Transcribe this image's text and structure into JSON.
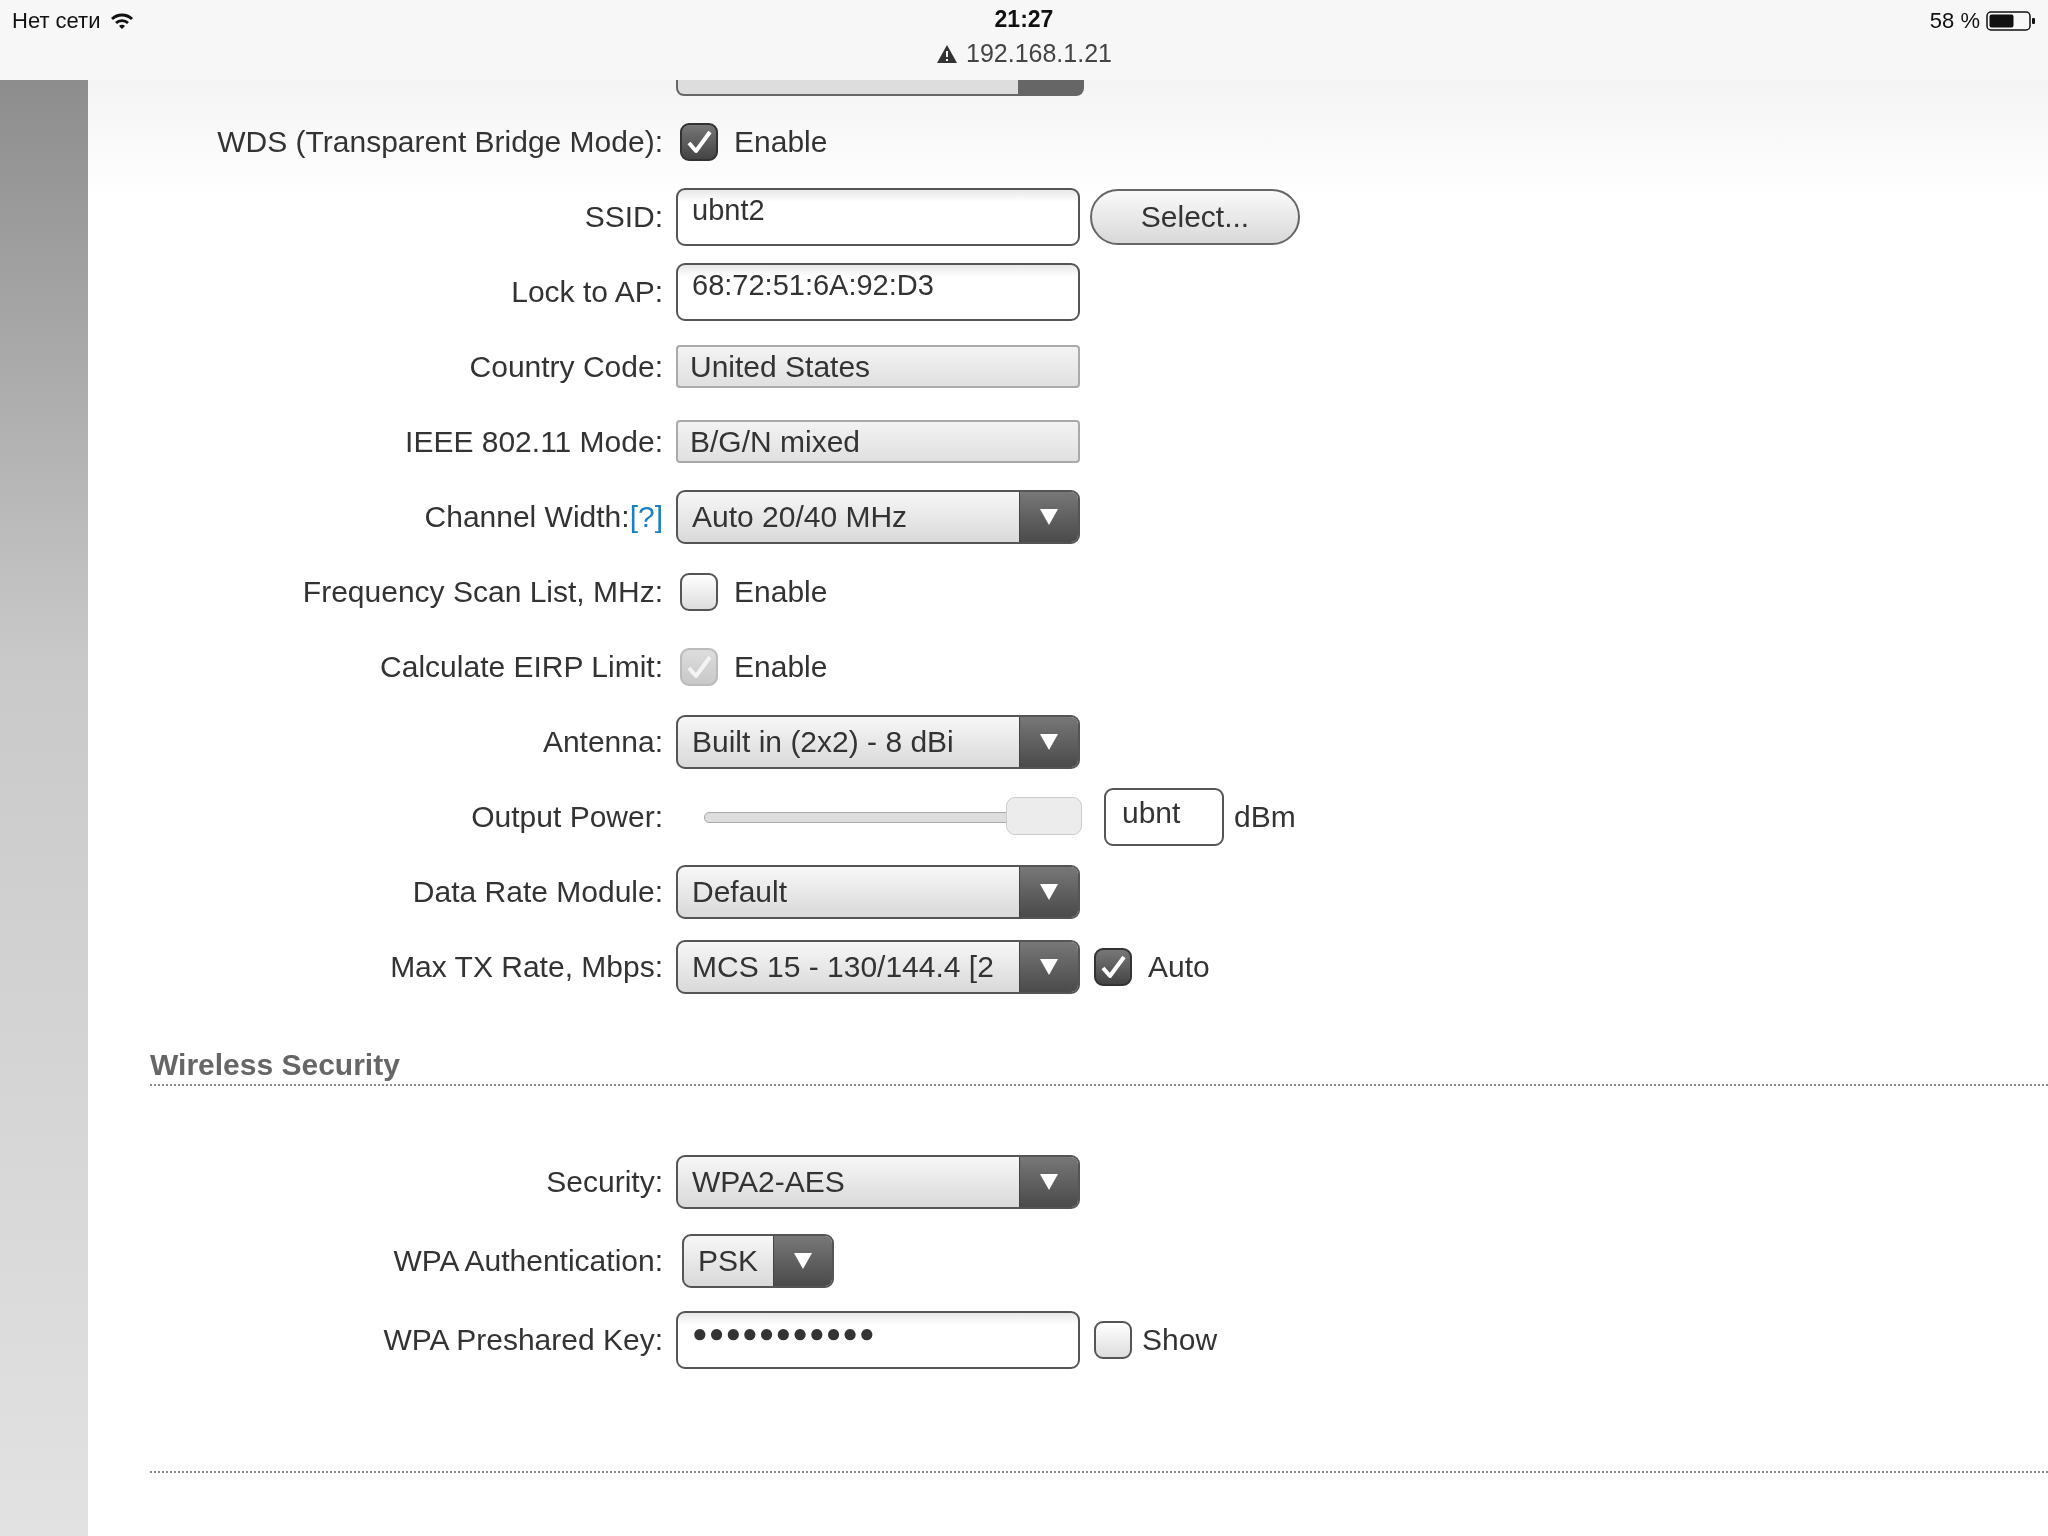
{
  "status_bar": {
    "carrier": "Нет сети",
    "time": "21:27",
    "url": "192.168.1.21",
    "battery": "58 %"
  },
  "wireless": {
    "rows": [
      {
        "kind": "checkbox",
        "label": "WDS (Transparent Bridge Mode):",
        "checked": true,
        "disabled": false,
        "option": "Enable"
      },
      {
        "kind": "text",
        "label": "SSID:",
        "value": "ubnt2",
        "button": "Select..."
      },
      {
        "kind": "text",
        "label": "Lock to AP:",
        "value": "68:72:51:6A:92:D3"
      },
      {
        "kind": "readonly",
        "label": "Country Code:",
        "value": "United States"
      },
      {
        "kind": "readonly",
        "label": "IEEE 802.11 Mode:",
        "value": "B/G/N mixed"
      },
      {
        "kind": "select",
        "label": "Channel Width:",
        "help": "[?]",
        "value": "Auto 20/40 MHz"
      },
      {
        "kind": "checkbox",
        "label": "Frequency Scan List, MHz:",
        "checked": false,
        "disabled": false,
        "option": "Enable"
      },
      {
        "kind": "checkbox",
        "label": "Calculate EIRP Limit:",
        "checked": true,
        "disabled": true,
        "option": "Enable"
      },
      {
        "kind": "select",
        "label": "Antenna:",
        "value": "Built in (2x2) - 8 dBi"
      },
      {
        "kind": "slider",
        "label": "Output Power:",
        "level": 1,
        "value": "ubnt",
        "unit": "dBm"
      },
      {
        "kind": "select",
        "label": "Data Rate Module:",
        "value": "Default"
      },
      {
        "kind": "select",
        "label": "Max TX Rate, Mbps:",
        "value": "MCS 15 - 130/144.4 [2",
        "option": "Auto",
        "checked": true
      }
    ]
  },
  "security": {
    "title": "Wireless Security",
    "rows": [
      {
        "kind": "select",
        "label": "Security:",
        "value": "WPA2-AES"
      },
      {
        "kind": "short-select",
        "label": "WPA Authentication:",
        "value": "PSK"
      },
      {
        "kind": "password",
        "label": "WPA Preshared Key:",
        "value": "●●●●●●●●●●●",
        "option": "Show",
        "checked": false
      }
    ]
  }
}
